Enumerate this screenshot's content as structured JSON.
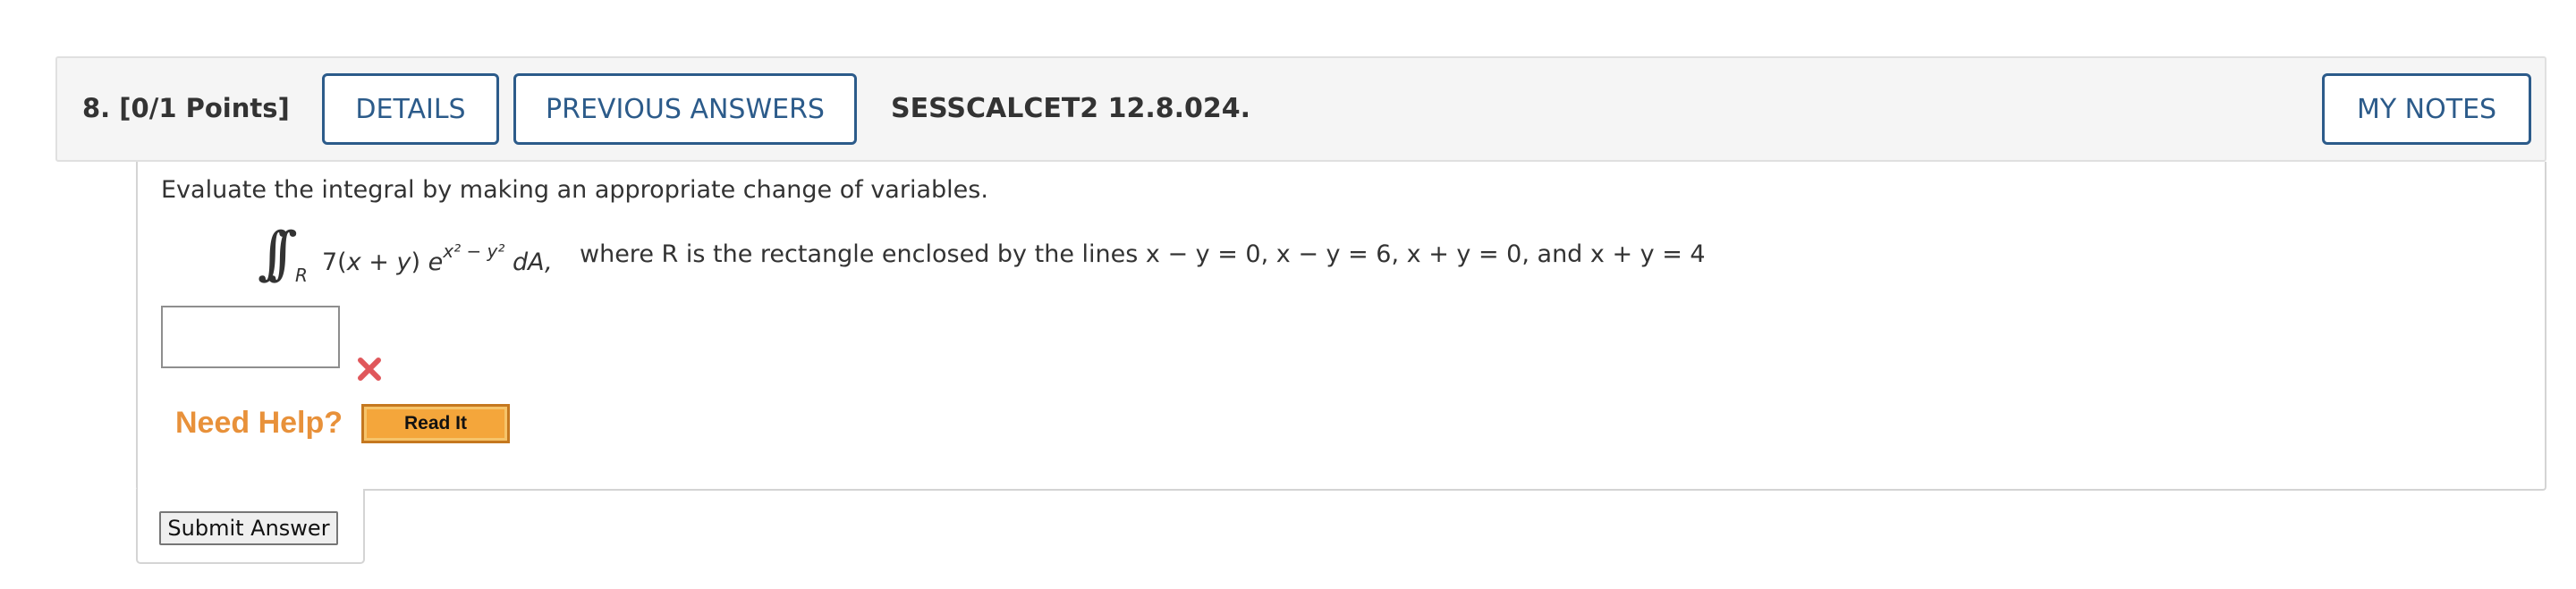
{
  "header": {
    "question_label": "8.  [0/1 Points]",
    "details_label": "DETAILS",
    "previous_answers_label": "PREVIOUS ANSWERS",
    "question_code": "SESSCALCET2 12.8.024.",
    "my_notes_label": "MY NOTES"
  },
  "question": {
    "prompt": "Evaluate the integral by making an appropriate change of variables.",
    "integral_symbol": "∫∫",
    "integral_region": "R",
    "integrand_coef": "7(",
    "integrand_x": "x",
    "integrand_plus": " + ",
    "integrand_y": "y",
    "integrand_close": ") ",
    "integrand_e": "e",
    "integrand_exponent": "x² − y²",
    "integrand_dA": " dA,",
    "region_description": "where R is the rectangle enclosed by the lines  x − y = 0,   x − y = 6,   x + y = 0,  and  x + y = 4"
  },
  "answer": {
    "value": "",
    "status": "incorrect",
    "status_icon": "x-mark-icon"
  },
  "help": {
    "label": "Need Help?",
    "read_it_label": "Read It"
  },
  "submit": {
    "label": "Submit Answer"
  },
  "colors": {
    "accent": "#2c5b8a",
    "help_orange": "#e8913a",
    "incorrect_red": "#e0575b",
    "read_it_fill": "#f4a63b"
  }
}
